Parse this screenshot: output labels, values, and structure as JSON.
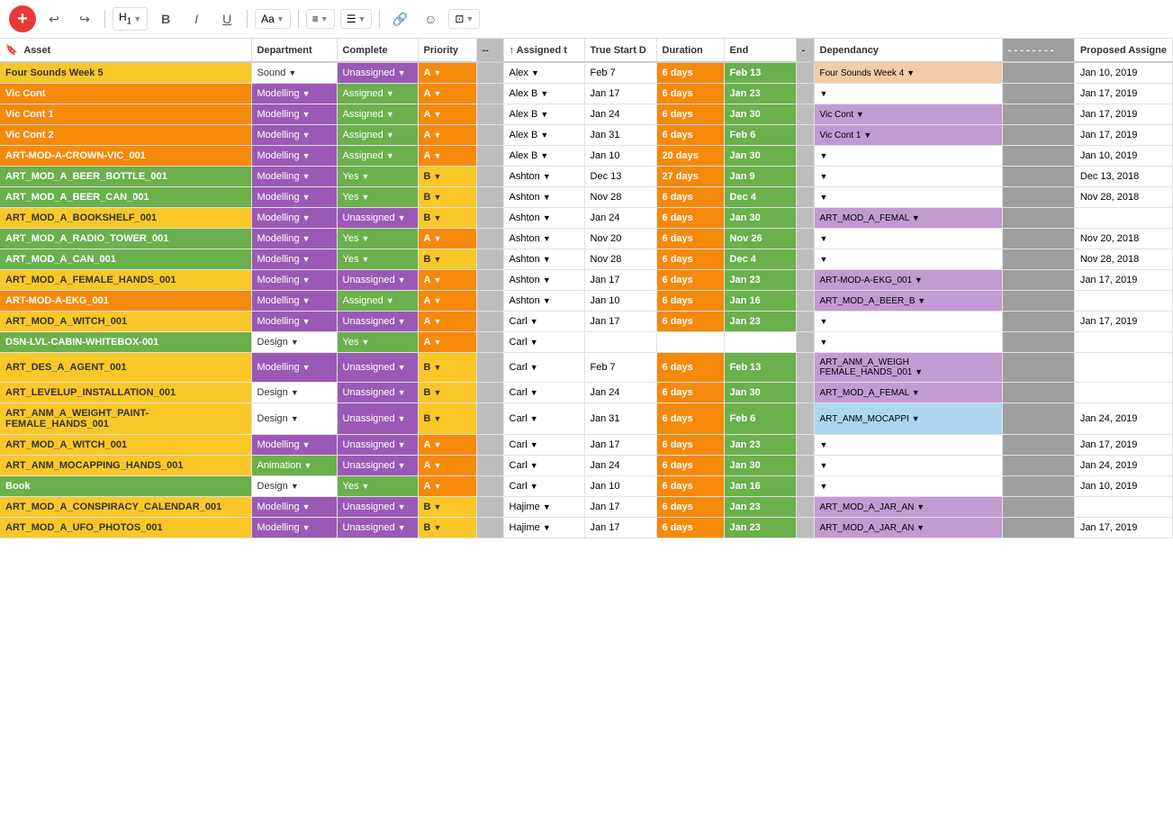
{
  "toolbar": {
    "add_label": "+",
    "undo_label": "↩",
    "redo_label": "↪",
    "heading_label": "H₁",
    "bold_label": "B",
    "italic_label": "I",
    "underline_label": "U",
    "font_label": "Aa",
    "align_label": "≡",
    "list_label": "≔",
    "link_label": "🔗",
    "emoji_label": "☺",
    "embed_label": "⊡"
  },
  "columns": [
    {
      "key": "asset",
      "label": "Asset",
      "icon": "bookmark"
    },
    {
      "key": "department",
      "label": "Department"
    },
    {
      "key": "complete",
      "label": "Complete"
    },
    {
      "key": "priority",
      "label": "Priority"
    },
    {
      "key": "dash1",
      "label": "--"
    },
    {
      "key": "assigned",
      "label": "↑ Assigned t"
    },
    {
      "key": "truestart",
      "label": "True Start D"
    },
    {
      "key": "duration",
      "label": "Duration"
    },
    {
      "key": "end",
      "label": "End"
    },
    {
      "key": "dash2",
      "label": "-"
    },
    {
      "key": "dependency",
      "label": "Dependancy"
    },
    {
      "key": "dashes",
      "label": "- - - - - - - -"
    },
    {
      "key": "proposed",
      "label": "Proposed Assigne"
    }
  ],
  "rows": [
    {
      "asset": "Four Sounds Week 5",
      "assetColor": "yellow",
      "department": "Sound",
      "deptColor": "",
      "complete": "Unassigned",
      "completeType": "unassigned",
      "priority": "A",
      "priorityType": "a",
      "assigned": "Alex",
      "trueStart": "Feb 7",
      "duration": "6 days",
      "end": "Feb 13",
      "endType": "green",
      "dependency": "Four Sounds Week 4",
      "depType": "peach",
      "proposed": "Jan 10, 2019"
    },
    {
      "asset": "Vic Cont",
      "assetColor": "orange",
      "department": "Modelling",
      "deptColor": "purple",
      "complete": "Assigned",
      "completeType": "assigned",
      "priority": "A",
      "priorityType": "a",
      "assigned": "Alex B",
      "trueStart": "Jan 17",
      "duration": "6 days",
      "end": "Jan 23",
      "endType": "green",
      "dependency": "",
      "depType": "empty",
      "proposed": "Jan 17, 2019"
    },
    {
      "asset": "Vic Cont 1",
      "assetColor": "orange",
      "department": "Modelling",
      "deptColor": "purple",
      "complete": "Assigned",
      "completeType": "assigned",
      "priority": "A",
      "priorityType": "a",
      "assigned": "Alex B",
      "trueStart": "Jan 24",
      "duration": "6 days",
      "end": "Jan 30",
      "endType": "green",
      "dependency": "Vic Cont",
      "depType": "purple",
      "proposed": "Jan 17, 2019"
    },
    {
      "asset": "Vic Cont 2",
      "assetColor": "orange",
      "department": "Modelling",
      "deptColor": "purple",
      "complete": "Assigned",
      "completeType": "assigned",
      "priority": "A",
      "priorityType": "a",
      "assigned": "Alex B",
      "trueStart": "Jan 31",
      "duration": "6 days",
      "end": "Feb 6",
      "endType": "green",
      "dependency": "Vic Cont 1",
      "depType": "purple",
      "proposed": "Jan 17, 2019"
    },
    {
      "asset": "ART-MOD-A-CROWN-VIC_001",
      "assetColor": "orange",
      "department": "Modelling",
      "deptColor": "purple",
      "complete": "Assigned",
      "completeType": "assigned",
      "priority": "A",
      "priorityType": "a",
      "assigned": "Alex B",
      "trueStart": "Jan 10",
      "duration": "20 days",
      "end": "Jan 30",
      "endType": "green",
      "dependency": "",
      "depType": "empty",
      "proposed": "Jan 10, 2019"
    },
    {
      "asset": "ART_MOD_A_BEER_BOTTLE_001",
      "assetColor": "green",
      "department": "Modelling",
      "deptColor": "purple",
      "complete": "Yes",
      "completeType": "yes",
      "priority": "B",
      "priorityType": "b",
      "assigned": "Ashton",
      "trueStart": "Dec 13",
      "duration": "27 days",
      "end": "Jan 9",
      "endType": "green",
      "dependency": "",
      "depType": "empty",
      "proposed": "Dec 13, 2018"
    },
    {
      "asset": "ART_MOD_A_BEER_CAN_001",
      "assetColor": "green",
      "department": "Modelling",
      "deptColor": "purple",
      "complete": "Yes",
      "completeType": "yes",
      "priority": "B",
      "priorityType": "b",
      "assigned": "Ashton",
      "trueStart": "Nov 28",
      "duration": "6 days",
      "end": "Dec 4",
      "endType": "green",
      "dependency": "",
      "depType": "empty",
      "proposed": "Nov 28, 2018"
    },
    {
      "asset": "ART_MOD_A_BOOKSHELF_001",
      "assetColor": "yellow",
      "department": "Modelling",
      "deptColor": "purple",
      "complete": "Unassigned",
      "completeType": "unassigned",
      "priority": "B",
      "priorityType": "b",
      "assigned": "Ashton",
      "trueStart": "Jan 24",
      "duration": "6 days",
      "end": "Jan 30",
      "endType": "green",
      "dependency": "ART_MOD_A_FEMAL",
      "depType": "purple",
      "proposed": ""
    },
    {
      "asset": "ART_MOD_A_RADIO_TOWER_001",
      "assetColor": "green",
      "department": "Modelling",
      "deptColor": "purple",
      "complete": "Yes",
      "completeType": "yes",
      "priority": "A",
      "priorityType": "a",
      "assigned": "Ashton",
      "trueStart": "Nov 20",
      "duration": "6 days",
      "end": "Nov 26",
      "endType": "green",
      "dependency": "",
      "depType": "empty",
      "proposed": "Nov 20, 2018"
    },
    {
      "asset": "ART_MOD_A_CAN_001",
      "assetColor": "green",
      "department": "Modelling",
      "deptColor": "purple",
      "complete": "Yes",
      "completeType": "yes",
      "priority": "B",
      "priorityType": "b",
      "assigned": "Ashton",
      "trueStart": "Nov 28",
      "duration": "6 days",
      "end": "Dec 4",
      "endType": "green",
      "dependency": "",
      "depType": "empty",
      "proposed": "Nov 28, 2018"
    },
    {
      "asset": "ART_MOD_A_FEMALE_HANDS_001",
      "assetColor": "yellow",
      "department": "Modelling",
      "deptColor": "purple",
      "complete": "Unassigned",
      "completeType": "unassigned",
      "priority": "A",
      "priorityType": "a",
      "assigned": "Ashton",
      "trueStart": "Jan 17",
      "duration": "6 days",
      "end": "Jan 23",
      "endType": "green",
      "dependency": "ART-MOD-A-EKG_001",
      "depType": "purple",
      "proposed": "Jan 17, 2019"
    },
    {
      "asset": "ART-MOD-A-EKG_001",
      "assetColor": "orange",
      "department": "Modelling",
      "deptColor": "purple",
      "complete": "Assigned",
      "completeType": "assigned",
      "priority": "A",
      "priorityType": "a",
      "assigned": "Ashton",
      "trueStart": "Jan 10",
      "duration": "6 days",
      "end": "Jan 16",
      "endType": "green",
      "dependency": "ART_MOD_A_BEER_B",
      "depType": "purple",
      "proposed": ""
    },
    {
      "asset": "ART_MOD_A_WITCH_001",
      "assetColor": "yellow",
      "department": "Modelling",
      "deptColor": "purple",
      "complete": "Unassigned",
      "completeType": "unassigned",
      "priority": "A",
      "priorityType": "a",
      "assigned": "Carl",
      "trueStart": "Jan 17",
      "duration": "6 days",
      "end": "Jan 23",
      "endType": "green",
      "dependency": "",
      "depType": "empty",
      "proposed": "Jan 17, 2019"
    },
    {
      "asset": "DSN-LVL-CABIN-WHITEBOX-001",
      "assetColor": "green",
      "department": "Design",
      "deptColor": "",
      "complete": "Yes",
      "completeType": "yes",
      "priority": "A",
      "priorityType": "a",
      "assigned": "Carl",
      "trueStart": "",
      "duration": "",
      "end": "",
      "endType": "empty",
      "dependency": "",
      "depType": "empty",
      "proposed": ""
    },
    {
      "asset": "ART_DES_A_AGENT_001",
      "assetColor": "yellow",
      "department": "Modelling",
      "deptColor": "purple",
      "complete": "Unassigned",
      "completeType": "unassigned",
      "priority": "B",
      "priorityType": "b",
      "assigned": "Carl",
      "trueStart": "Feb 7",
      "duration": "6 days",
      "end": "Feb 13",
      "endType": "green",
      "dependency": "ART_ANM_A_WEIGH FEMALE_HANDS_001",
      "depType": "purple",
      "proposed": ""
    },
    {
      "asset": "ART_LEVELUP_INSTALLATION_001",
      "assetColor": "yellow",
      "department": "Design",
      "deptColor": "",
      "complete": "Unassigned",
      "completeType": "unassigned",
      "priority": "B",
      "priorityType": "b",
      "assigned": "Carl",
      "trueStart": "Jan 24",
      "duration": "6 days",
      "end": "Jan 30",
      "endType": "green",
      "dependency": "ART_MOD_A_FEMAL",
      "depType": "purple",
      "proposed": ""
    },
    {
      "asset": "ART_ANM_A_WEIGHT_PAINT-FEMALE_HANDS_001",
      "assetColor": "yellow",
      "department": "Design",
      "deptColor": "",
      "complete": "Unassigned",
      "completeType": "unassigned",
      "priority": "B",
      "priorityType": "b",
      "assigned": "Carl",
      "trueStart": "Jan 31",
      "duration": "6 days",
      "end": "Feb 6",
      "endType": "green",
      "dependency": "ART_ANM_MOCAPPI",
      "depType": "lightblue",
      "proposed": "Jan 24, 2019"
    },
    {
      "asset": "ART_MOD_A_WITCH_001",
      "assetColor": "yellow",
      "department": "Modelling",
      "deptColor": "purple",
      "complete": "Unassigned",
      "completeType": "unassigned",
      "priority": "A",
      "priorityType": "a",
      "assigned": "Carl",
      "trueStart": "Jan 17",
      "duration": "6 days",
      "end": "Jan 23",
      "endType": "green",
      "dependency": "",
      "depType": "empty",
      "proposed": "Jan 17, 2019"
    },
    {
      "asset": "ART_ANM_MOCAPPING_HANDS_001",
      "assetColor": "yellow",
      "department": "Animation",
      "deptColor": "green",
      "complete": "Unassigned",
      "completeType": "unassigned",
      "priority": "A",
      "priorityType": "a",
      "assigned": "Carl",
      "trueStart": "Jan 24",
      "duration": "6 days",
      "end": "Jan 30",
      "endType": "green",
      "dependency": "",
      "depType": "empty",
      "proposed": "Jan 24, 2019"
    },
    {
      "asset": "Book",
      "assetColor": "green",
      "department": "Design",
      "deptColor": "",
      "complete": "Yes",
      "completeType": "yes",
      "priority": "A",
      "priorityType": "a",
      "assigned": "Carl",
      "trueStart": "Jan 10",
      "duration": "6 days",
      "end": "Jan 16",
      "endType": "green",
      "dependency": "",
      "depType": "empty",
      "proposed": "Jan 10, 2019"
    },
    {
      "asset": "ART_MOD_A_CONSPIRACY_CALENDAR_001",
      "assetColor": "yellow",
      "department": "Modelling",
      "deptColor": "purple",
      "complete": "Unassigned",
      "completeType": "unassigned",
      "priority": "B",
      "priorityType": "b",
      "assigned": "Hajime",
      "trueStart": "Jan 17",
      "duration": "6 days",
      "end": "Jan 23",
      "endType": "green",
      "dependency": "ART_MOD_A_JAR_AN",
      "depType": "purple",
      "proposed": ""
    },
    {
      "asset": "ART_MOD_A_UFO_PHOTOS_001",
      "assetColor": "yellow",
      "department": "Modelling",
      "deptColor": "purple",
      "complete": "Unassigned",
      "completeType": "unassigned",
      "priority": "B",
      "priorityType": "b",
      "assigned": "Hajime",
      "trueStart": "Jan 17",
      "duration": "6 days",
      "end": "Jan 23",
      "endType": "green",
      "dependency": "ART_MOD_A_JAR_AN",
      "depType": "purple",
      "proposed": "Jan 17, 2019"
    }
  ]
}
